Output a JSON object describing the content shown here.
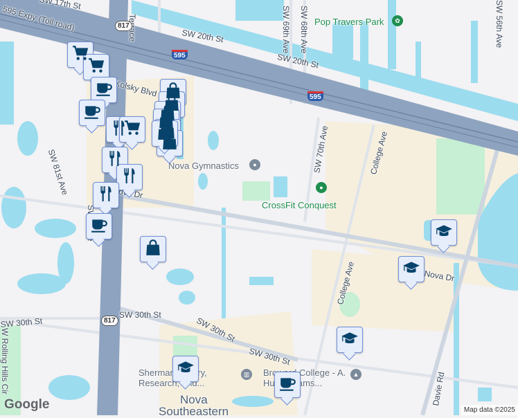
{
  "map": {
    "roads": {
      "expressway": "595 Expy (Toll road)",
      "sw_17th": "SW 17th St",
      "terrace": "Terrace",
      "sw_20th_a": "SW 20th St",
      "sw_20th_b": "SW 20th St",
      "sw_69th": "SW 69th Ave",
      "sw_68th": "SW 68th Ave",
      "sw_70th": "SW 70th Ave",
      "sw_56th": "SW 56th Ave",
      "kolsky": "Kolsky Blvd",
      "sw_81st": "SW 81st Ave",
      "nova_dr_a": "Nova Dr",
      "nova_dr_b": "Nova Dr",
      "college_a": "College Ave",
      "college_b": "College Ave",
      "sw_30th_a": "SW 30th St",
      "sw_30th_b": "SW 30th St",
      "sw_30th_c": "SW 30th St",
      "rolling_hills": "W Rolling Hills Cir",
      "davie": "Davie Rd",
      "sw_a": "SW 8 Ave"
    },
    "shields": {
      "state": "817",
      "state_b": "817",
      "interstate": "595",
      "interstate_b": "595"
    },
    "places": {
      "pop_travers": "Pop Travers Park",
      "nova_gymnastics": "Nova Gymnastics",
      "crossfit": "CrossFit Conquest",
      "sherman": "Sherman Library, Research, and...",
      "broward": "Broward College - A. Hugh Adams...",
      "nova_se_1": "Nova",
      "nova_se_2": "Southeastern"
    },
    "markers": [
      "shopping-cart",
      "shopping-cart",
      "coffee",
      "coffee",
      "restaurant",
      "shopping-cart",
      "shopping-bag",
      "shopping-bag",
      "shopping-bag",
      "shopping-bag",
      "shopping-bag",
      "shopping-bag",
      "shopping-bag",
      "restaurant",
      "restaurant",
      "restaurant",
      "coffee",
      "shopping-bag",
      "school",
      "school",
      "school",
      "school",
      "coffee"
    ],
    "colors": {
      "marker_icon": "#08436b",
      "marker_bg": "#e6edfb",
      "water": "#9bdcef",
      "highway": "#8ea3bf",
      "park": "#c6efd3"
    },
    "logo": "Google",
    "attribution": "Map data ©2025"
  }
}
